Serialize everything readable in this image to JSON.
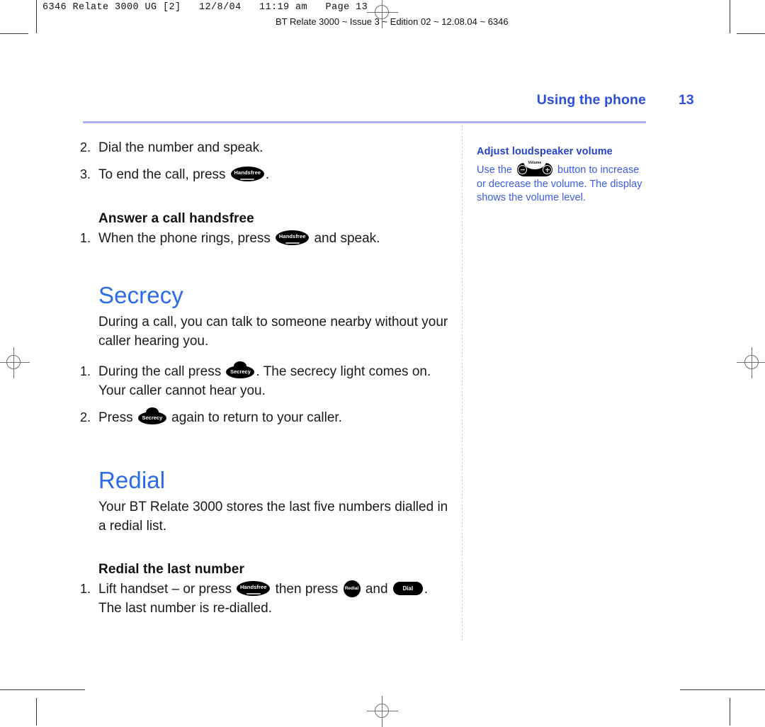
{
  "printer_slug": {
    "line1": "6346 Relate 3000 UG [2]   12/8/04   11:19 am   Page 13",
    "line2": "BT Relate 3000 ~ Issue 3 ~ Edition 02 ~ 12.08.04 ~ 6346"
  },
  "header": {
    "running_head": "Using the phone",
    "page_number": "13",
    "rule_color": "#a9aff0",
    "accent_color": "#2b4fe0"
  },
  "keys": {
    "handsfree": "Handsfree",
    "secrecy": "Secrecy",
    "redial": "Redial",
    "dial": "Dial",
    "volume": "Volume"
  },
  "main": {
    "step2": {
      "num": "2.",
      "text": "Dial the number and speak."
    },
    "step3": {
      "num": "3.",
      "before": "To end the call, press",
      "after": "."
    },
    "answer_handsfree": {
      "subhead": "Answer a call handsfree",
      "step1_num": "1.",
      "step1_before": "When the phone rings, press",
      "step1_after": "and speak."
    },
    "secrecy": {
      "title": "Secrecy",
      "intro": "During a call, you can talk to someone nearby without your caller hearing you.",
      "step1_num": "1.",
      "step1_before": "During the call press",
      "step1_after": ". The secrecy light comes on. Your caller cannot hear you.",
      "step2_num": "2.",
      "step2_before": "Press",
      "step2_after": "again to return to your caller."
    },
    "redial": {
      "title": "Redial",
      "intro": "Your BT Relate 3000 stores the last five numbers dialled in a redial list.",
      "subhead": "Redial the last number",
      "step1_num": "1.",
      "step1_a": "Lift handset – or press",
      "step1_b": "then press",
      "step1_c": "and",
      "step1_d": ". The last number is re-dialled."
    }
  },
  "sidebar": {
    "heading": "Adjust loudspeaker volume",
    "text_before": "Use the",
    "text_after": "button to increase or decrease the volume. The display shows the volume level.",
    "text_color": "#3b5ce8"
  }
}
